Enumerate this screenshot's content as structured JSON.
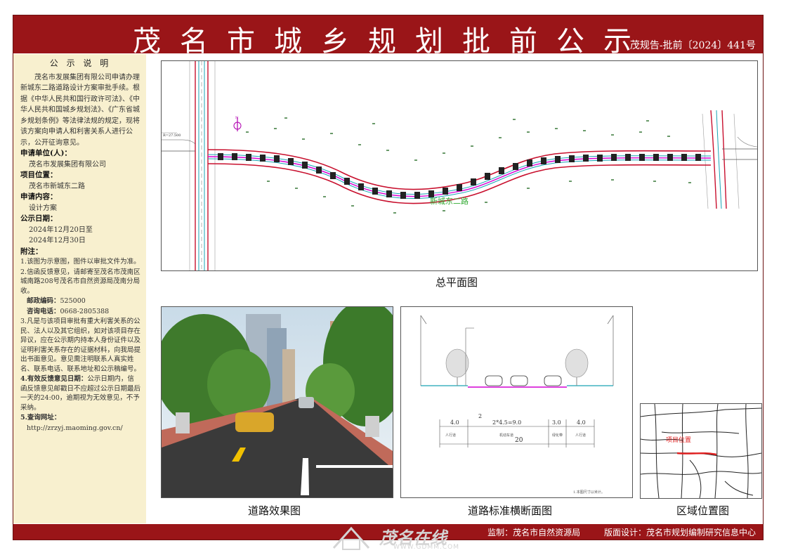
{
  "header": {
    "title": "茂名市城乡规划批前公示",
    "doc_number": "茂规告-批前〔2024〕441号"
  },
  "notice": {
    "heading": "公 示 说 明",
    "intro": "茂名市发展集团有限公司申请办理新城东二路道路设计方案审批手续。根据《中华人民共和国行政许可法》、《中华人民共和国城乡规划法》、《广东省城乡规划条例》等法律法规的规定，现将该方案向申请人和利害关系人进行公示，公开征询意见。",
    "applicant_label": "申请单位(人)：",
    "applicant": "茂名市发展集团有限公司",
    "location_label": "项目位置：",
    "location": "茂名市新城东二路",
    "content_label": "申请内容：",
    "content": "设计方案",
    "date_label": "公示日期：",
    "date_start": "2024年12月20日至",
    "date_end": "2024年12月30日",
    "notes_label": "附注：",
    "note1": "1.该图为示意图，图件以审批文件为准。",
    "note2": "2.信函反馈意见，请邮寄至茂名市茂南区城南路208号茂名市自然资源局茂南分局收。",
    "postcode_label": "邮政编码：",
    "postcode": "525000",
    "phone_label": "咨询电话：",
    "phone": "0668-2805388",
    "note3": "3.凡是与该项目审批有重大利害关系的公民、法人以及其它组织，如对该项目存在异议，应在公示期内持本人身份证件以及证明利害关系存在的证据材料，向我局提出书面意见。意见需注明联系人真实姓名、联系电话、联系地址和公示稿编号。",
    "note4_label": "4.有效反馈意见日期：",
    "note4": "公示日期内，信函反馈意见邮戳日不应超过公示日期最后一天的24:00，逾期视为无效意见，不予采纳。",
    "note5_label": "5.查询网址：",
    "website": "http://zrzyj.maoming.gov.cn/"
  },
  "plan": {
    "caption": "总平面图",
    "road_label": "新城东二路",
    "north_label": "N",
    "left_note": "R=27.500"
  },
  "render": {
    "caption": "道路效果图"
  },
  "section": {
    "caption": "道路标准横断面图",
    "dims_top": [
      "4.0",
      "2",
      "2*4.5=9.0",
      "3.0",
      "4.0"
    ],
    "total_width": "20",
    "bottom_labels": [
      "人行道",
      "机动车道",
      "绿化带",
      "人行道"
    ],
    "note": "1.本图尺寸以米计。"
  },
  "location_map": {
    "caption": "区域位置图",
    "marker_label": "项目位置"
  },
  "footer": {
    "supervisor": "监制：茂名市自然资源局",
    "designer": "版面设计：茂名市规划编制研究信息中心"
  },
  "watermark": {
    "text": "茂名在线",
    "url": "WWW.GDMM.COM"
  },
  "colors": {
    "banner": "#9a1518",
    "panel": "#f8f0cf",
    "road_edge": "#c8102e",
    "center_line": "#d400d4"
  }
}
